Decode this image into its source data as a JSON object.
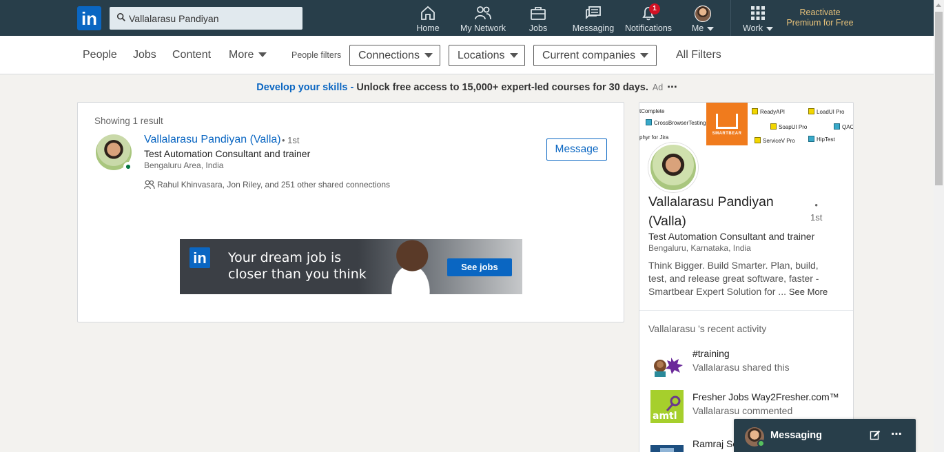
{
  "topnav": {
    "logo": "in",
    "search": {
      "value": "Vallalarasu Pandiyan",
      "placeholder": "Search"
    },
    "items": [
      {
        "label": "Home",
        "icon": "home-icon"
      },
      {
        "label": "My Network",
        "icon": "network-icon"
      },
      {
        "label": "Jobs",
        "icon": "briefcase-icon"
      },
      {
        "label": "Messaging",
        "icon": "messaging-icon"
      },
      {
        "label": "Notifications",
        "icon": "bell-icon",
        "badge": "1"
      },
      {
        "label": "Me",
        "icon": "avatar"
      },
      {
        "label": "Work",
        "icon": "grid-icon"
      }
    ],
    "premium": {
      "line1": "Reactivate",
      "line2": "Premium for Free"
    }
  },
  "filters": {
    "tabs": [
      "People",
      "Jobs",
      "Content",
      "More"
    ],
    "people_filters_label": "People filters",
    "dropdowns": [
      "Connections",
      "Locations",
      "Current companies"
    ],
    "all_filters": "All Filters"
  },
  "ad": {
    "link": "Develop your skills -",
    "text": " Unlock free access to 15,000+ expert-led courses for 30 days.",
    "tag": "Ad",
    "more": "⋯"
  },
  "results": {
    "showing": "Showing 1 result",
    "item": {
      "name": "Vallalarasu Pandiyan (Valla)",
      "degree": "• 1st",
      "headline": "Test Automation Consultant and trainer",
      "location": "Bengaluru Area, India",
      "shared": "Rahul Khinvasara, Jon Riley, and 251 other shared connections",
      "action": "Message"
    },
    "banner": {
      "logo": "in",
      "line1": "Your dream job is",
      "line2": "closer than you think",
      "cta": "See jobs"
    }
  },
  "profile": {
    "cover": {
      "brand": "SMARTBEAR",
      "products": [
        "tComplete",
        "ReadyAPI",
        "LoadUI Pro",
        "CrossBrowserTesting",
        "SoapUI Pro",
        "QAC",
        "phyr for Jira",
        "ServiceV Pro",
        "HipTest"
      ]
    },
    "name": "Vallalarasu Pandiyan (Valla)",
    "degree_dot": "•",
    "degree": "1st",
    "headline": "Test Automation Consultant and trainer",
    "location": "Bengaluru, Karnataka, India",
    "about": "Think Bigger. Build Smarter. Plan, build, test, and release great software, faster - Smartbear Expert Solution for ...",
    "see_more": "See More",
    "activity_title": "Vallalarasu 's recent activity",
    "activity": [
      {
        "title": "#training",
        "subtitle": "Vallalarasu shared this"
      },
      {
        "title": "Fresher Jobs Way2Fresher.com™",
        "subtitle": "Vallalarasu commented"
      },
      {
        "title": "Ramraj Se",
        "subtitle": ""
      }
    ]
  },
  "messaging_bar": {
    "label": "Messaging",
    "more": "⋯"
  },
  "colors": {
    "nav": "#283e4a",
    "accent": "#0a66c2",
    "premium": "#e8c27a",
    "smartbear": "#f07b1d"
  }
}
